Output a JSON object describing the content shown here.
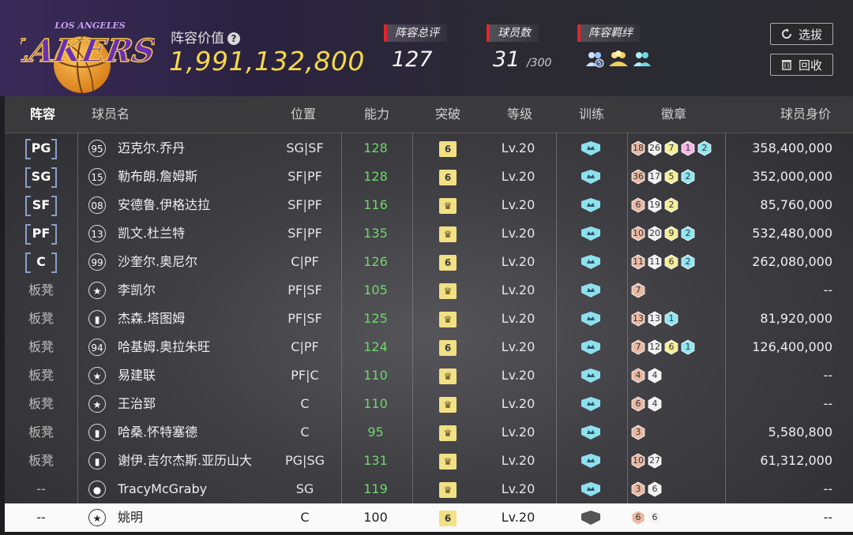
{
  "header": {
    "team_logo_text": "LAKERS",
    "team_logo_sub": "LOS ANGELES",
    "lineup_value_label": "阵容价值",
    "lineup_value": "1,991,132,800",
    "stats": [
      {
        "label": "阵容总评",
        "value": "127",
        "suffix": ""
      },
      {
        "label": "球员数",
        "value": "31",
        "suffix": "/300"
      },
      {
        "label": "阵容羁绊",
        "value": "",
        "suffix": ""
      }
    ],
    "buttons": {
      "select": "选拔",
      "recycle": "回收"
    }
  },
  "columns": [
    "阵容",
    "球员名",
    "位置",
    "能力",
    "突破",
    "等级",
    "训练",
    "徽章",
    "球员身价"
  ],
  "players": [
    {
      "slot": "PG",
      "slot_type": "starter",
      "emblem": "95",
      "name": "迈克尔.乔丹",
      "pos": "SG|SF",
      "ability": "128",
      "breakthrough": "6",
      "level": "Lv.20",
      "badges": [
        {
          "n": "18",
          "c": "bronze"
        },
        {
          "n": "26",
          "c": "silver"
        },
        {
          "n": "7",
          "c": "gold"
        },
        {
          "n": "1",
          "c": "pink"
        },
        {
          "n": "2",
          "c": "blue"
        }
      ],
      "value": "358,400,000"
    },
    {
      "slot": "SG",
      "slot_type": "starter",
      "emblem": "15",
      "name": "勒布朗.詹姆斯",
      "pos": "SF|PF",
      "ability": "128",
      "breakthrough": "6",
      "level": "Lv.20",
      "badges": [
        {
          "n": "36",
          "c": "bronze"
        },
        {
          "n": "17",
          "c": "silver"
        },
        {
          "n": "5",
          "c": "gold"
        },
        {
          "n": "2",
          "c": "blue"
        }
      ],
      "value": "352,000,000"
    },
    {
      "slot": "SF",
      "slot_type": "starter",
      "emblem": "08",
      "name": "安德鲁.伊格达拉",
      "pos": "SF|PF",
      "ability": "116",
      "breakthrough": "crown",
      "level": "Lv.20",
      "badges": [
        {
          "n": "6",
          "c": "bronze"
        },
        {
          "n": "19",
          "c": "silver"
        },
        {
          "n": "2",
          "c": "gold"
        }
      ],
      "value": "85,760,000"
    },
    {
      "slot": "PF",
      "slot_type": "starter",
      "emblem": "13",
      "name": "凯文.杜兰特",
      "pos": "SF|PF",
      "ability": "135",
      "breakthrough": "crown",
      "level": "Lv.20",
      "badges": [
        {
          "n": "10",
          "c": "bronze"
        },
        {
          "n": "20",
          "c": "silver"
        },
        {
          "n": "9",
          "c": "gold"
        },
        {
          "n": "2",
          "c": "blue"
        }
      ],
      "value": "532,480,000"
    },
    {
      "slot": "C",
      "slot_type": "starter",
      "emblem": "99",
      "name": "沙奎尔.奥尼尔",
      "pos": "C|PF",
      "ability": "126",
      "breakthrough": "6",
      "level": "Lv.20",
      "badges": [
        {
          "n": "11",
          "c": "bronze"
        },
        {
          "n": "11",
          "c": "silver"
        },
        {
          "n": "6",
          "c": "gold"
        },
        {
          "n": "2",
          "c": "blue"
        }
      ],
      "value": "262,080,000"
    },
    {
      "slot": "板凳",
      "slot_type": "bench",
      "emblem": "star",
      "name": "李凯尔",
      "pos": "PF|SF",
      "ability": "105",
      "breakthrough": "crown",
      "level": "Lv.20",
      "badges": [
        {
          "n": "7",
          "c": "bronze"
        }
      ],
      "value": "--"
    },
    {
      "slot": "板凳",
      "slot_type": "bench",
      "emblem": "bars",
      "name": "杰森.塔图姆",
      "pos": "PF|SF",
      "ability": "125",
      "breakthrough": "crown",
      "level": "Lv.20",
      "badges": [
        {
          "n": "13",
          "c": "bronze"
        },
        {
          "n": "13",
          "c": "silver"
        },
        {
          "n": "1",
          "c": "blue"
        }
      ],
      "value": "81,920,000"
    },
    {
      "slot": "板凳",
      "slot_type": "bench",
      "emblem": "94",
      "name": "哈基姆.奥拉朱旺",
      "pos": "C|PF",
      "ability": "124",
      "breakthrough": "6",
      "level": "Lv.20",
      "badges": [
        {
          "n": "7",
          "c": "bronze"
        },
        {
          "n": "12",
          "c": "silver"
        },
        {
          "n": "6",
          "c": "gold"
        },
        {
          "n": "1",
          "c": "blue"
        }
      ],
      "value": "126,400,000"
    },
    {
      "slot": "板凳",
      "slot_type": "bench",
      "emblem": "star",
      "name": "易建联",
      "pos": "PF|C",
      "ability": "110",
      "breakthrough": "crown",
      "level": "Lv.20",
      "badges": [
        {
          "n": "4",
          "c": "bronze"
        },
        {
          "n": "4",
          "c": "silver"
        }
      ],
      "value": "--"
    },
    {
      "slot": "板凳",
      "slot_type": "bench",
      "emblem": "star",
      "name": "王治郅",
      "pos": "C",
      "ability": "110",
      "breakthrough": "crown",
      "level": "Lv.20",
      "badges": [
        {
          "n": "6",
          "c": "bronze"
        },
        {
          "n": "4",
          "c": "silver"
        }
      ],
      "value": "--"
    },
    {
      "slot": "板凳",
      "slot_type": "bench",
      "emblem": "bars",
      "name": "哈桑.怀特塞德",
      "pos": "C",
      "ability": "95",
      "breakthrough": "crown",
      "level": "Lv.20",
      "badges": [
        {
          "n": "3",
          "c": "bronze"
        }
      ],
      "value": "5,580,800"
    },
    {
      "slot": "板凳",
      "slot_type": "bench",
      "emblem": "bars",
      "name": "谢伊.吉尔杰斯.亚历山大",
      "pos": "PG|SG",
      "ability": "131",
      "breakthrough": "crown",
      "level": "Lv.20",
      "badges": [
        {
          "n": "10",
          "c": "bronze"
        },
        {
          "n": "27",
          "c": "silver"
        }
      ],
      "value": "61,312,000"
    },
    {
      "slot": "--",
      "slot_type": "none",
      "emblem": "person",
      "name": "TracyMcGraby",
      "pos": "SG",
      "ability": "119",
      "breakthrough": "crown",
      "level": "Lv.20",
      "badges": [
        {
          "n": "3",
          "c": "bronze"
        },
        {
          "n": "6",
          "c": "silver"
        }
      ],
      "value": "--"
    },
    {
      "slot": "--",
      "slot_type": "none",
      "emblem": "star",
      "name": "姚明",
      "pos": "C",
      "ability": "100",
      "breakthrough": "6",
      "level": "Lv.20",
      "badges": [
        {
          "n": "6",
          "c": "bronze"
        },
        {
          "n": "6",
          "c": "silver"
        }
      ],
      "value": "--",
      "selected": true
    }
  ],
  "colors": {
    "accent_value": "#f6d84a",
    "ability_green": "#6fd86a",
    "tag_red": "#e0262c",
    "training_icon": "#8ee0ee",
    "breakthrough_chip": "#f2e184"
  }
}
